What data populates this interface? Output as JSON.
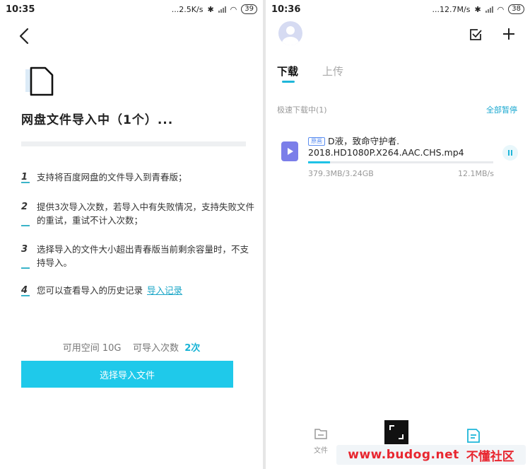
{
  "left": {
    "status": {
      "time": "10:35",
      "net": "...2.5K/s",
      "battery": "39"
    },
    "title": "网盘文件导入中（1个）...",
    "notes": [
      {
        "num": "1",
        "text": "支持将百度网盘的文件导入到青春版；"
      },
      {
        "num": "2",
        "text": "提供3次导入次数，若导入中有失败情况，支持失败文件的重试，重试不计入次数；"
      },
      {
        "num": "3",
        "text": "选择导入的文件大小超出青春版当前剩余容量时，不支持导入。"
      },
      {
        "num": "4",
        "text": "您可以查看导入的历史记录",
        "link": "导入记录"
      }
    ],
    "space": {
      "label": "可用空间 10G",
      "count_label": "可导入次数",
      "count": "2次"
    },
    "select_button": "选择导入文件"
  },
  "right": {
    "status": {
      "time": "10:36",
      "net": "...12.7M/s",
      "battery": "38"
    },
    "tabs": [
      {
        "label": "下载",
        "active": true
      },
      {
        "label": "上传",
        "active": false
      }
    ],
    "section_label": "极速下载中(1)",
    "pause_all": "全部暂停",
    "download": {
      "badge": "原画",
      "filename_line1": "D液，致命守护者.",
      "filename_line2": "2018.HD1080P.X264.AAC.CHS.mp4",
      "downloaded": "379.3MB/3.24GB",
      "speed": "12.1MB/s",
      "progress_fraction": 0.12
    },
    "nav": {
      "files_label": "文件"
    }
  },
  "watermark": {
    "site": "www.budog.net",
    "name": "不懂社区"
  },
  "colors": {
    "accent": "#1fc9ea",
    "link": "#1aa6c7",
    "file_icon": "#7b7ee9"
  }
}
